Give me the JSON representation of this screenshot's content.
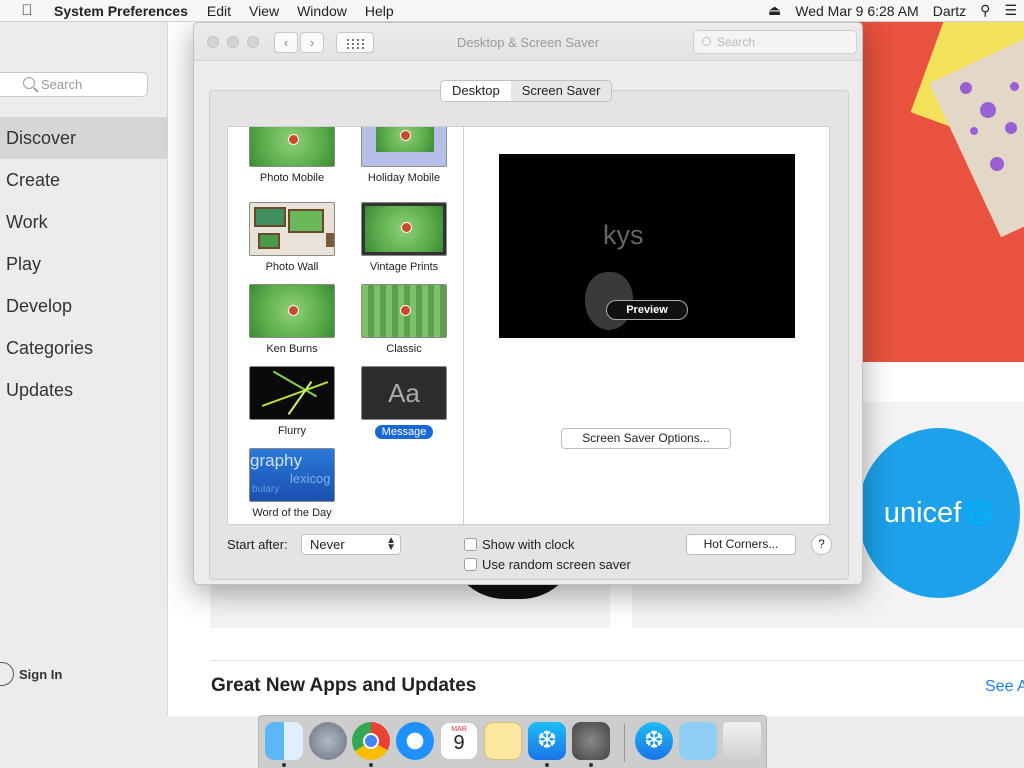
{
  "menubar": {
    "app_name": "System Preferences",
    "menus": [
      "Edit",
      "View",
      "Window",
      "Help"
    ],
    "clock": "Wed Mar 9  6:28 AM",
    "user": "Dartz"
  },
  "appstore": {
    "search_placeholder": "Search",
    "nav": [
      "Discover",
      "Create",
      "Work",
      "Play",
      "Develop",
      "Categories",
      "Updates"
    ],
    "selected_nav": "Discover",
    "sign_in": "Sign In",
    "featured_logo": "unicef",
    "section_title": "Great New Apps and Updates",
    "see_all": "See A"
  },
  "window": {
    "title": "Desktop & Screen Saver",
    "search_placeholder": "Search",
    "tabs": [
      "Desktop",
      "Screen Saver"
    ],
    "selected_tab": "Screen Saver"
  },
  "savers": [
    {
      "label": "Photo Mobile"
    },
    {
      "label": "Holiday Mobile"
    },
    {
      "label": "Photo Wall"
    },
    {
      "label": "Vintage Prints"
    },
    {
      "label": "Ken Burns"
    },
    {
      "label": "Classic"
    },
    {
      "label": "Flurry"
    },
    {
      "label": "Message",
      "selected": true,
      "thumb_text": "Aa"
    },
    {
      "label": "Word of the Day",
      "thumb_text_1": "graphy",
      "thumb_text_2": "lexicog",
      "thumb_text_3": "bulary"
    }
  ],
  "preview": {
    "message_text": "kys",
    "preview_button": "Preview",
    "options_button": "Screen Saver Options..."
  },
  "bottom": {
    "start_after_label": "Start after:",
    "start_after_value": "Never",
    "show_with_clock": "Show with clock",
    "use_random": "Use random screen saver",
    "hot_corners": "Hot Corners...",
    "help": "?"
  },
  "dock": {
    "apps": [
      "Finder",
      "Launchpad",
      "Chrome",
      "Safari",
      "Calendar",
      "Notes",
      "App Store",
      "System Preferences",
      "App Store Downloads",
      "Downloads",
      "Trash"
    ],
    "calendar_month": "MAR",
    "calendar_day": "9"
  },
  "colors": {
    "accent": "#1868d8",
    "unicef": "#1ca1ea",
    "hero": "#e8523f"
  }
}
